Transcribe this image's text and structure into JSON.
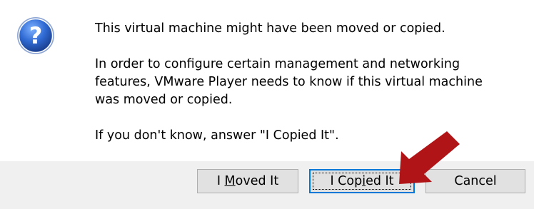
{
  "dialog": {
    "message_line1": "This virtual machine might have been moved or copied.",
    "message_line2": "In order to configure certain management and networking\nfeatures, VMware Player needs to know if this virtual machine\nwas moved or copied.",
    "message_line3": "If you don't know, answer \"I Copied It\".",
    "icon": "question-icon"
  },
  "buttons": {
    "moved": {
      "before": "I ",
      "accel": "M",
      "after": "oved It"
    },
    "copied": {
      "before": "I Cop",
      "accel": "i",
      "after": "ed It"
    },
    "cancel": "Cancel"
  },
  "colors": {
    "icon_blue": "#2c63c5",
    "focus_border": "#0078d7",
    "arrow_red": "#b01417",
    "button_bar": "#f0f0f0"
  }
}
